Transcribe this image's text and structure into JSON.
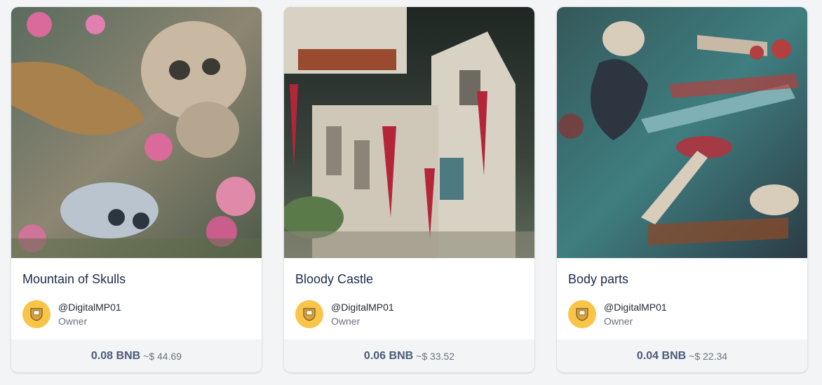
{
  "cards": [
    {
      "title": "Mountain of Skulls",
      "owner_handle": "@DigitalMP01",
      "owner_role": "Owner",
      "price_bnb": "0.08 BNB",
      "price_usd": "~$ 44.69",
      "art_palette": [
        "#6b7a6e",
        "#c9b9a3",
        "#d96a9a",
        "#7fa7c9"
      ]
    },
    {
      "title": "Bloody Castle",
      "owner_handle": "@DigitalMP01",
      "owner_role": "Owner",
      "price_bnb": "0.06 BNB",
      "price_usd": "~$ 33.52",
      "art_palette": [
        "#2f3a36",
        "#d8d2c4",
        "#b3263a",
        "#5b7a4a"
      ]
    },
    {
      "title": "Body parts",
      "owner_handle": "@DigitalMP01",
      "owner_role": "Owner",
      "price_bnb": "0.04 BNB",
      "price_usd": "~$ 22.34",
      "art_palette": [
        "#3f7e80",
        "#c8b9a6",
        "#b3403f",
        "#2c3b45"
      ]
    }
  ],
  "colors": {
    "page_bg": "#f3f4f6",
    "avatar_bg": "#f8c548",
    "title_text": "#1e2a4a",
    "price_text": "#4b5a78"
  }
}
